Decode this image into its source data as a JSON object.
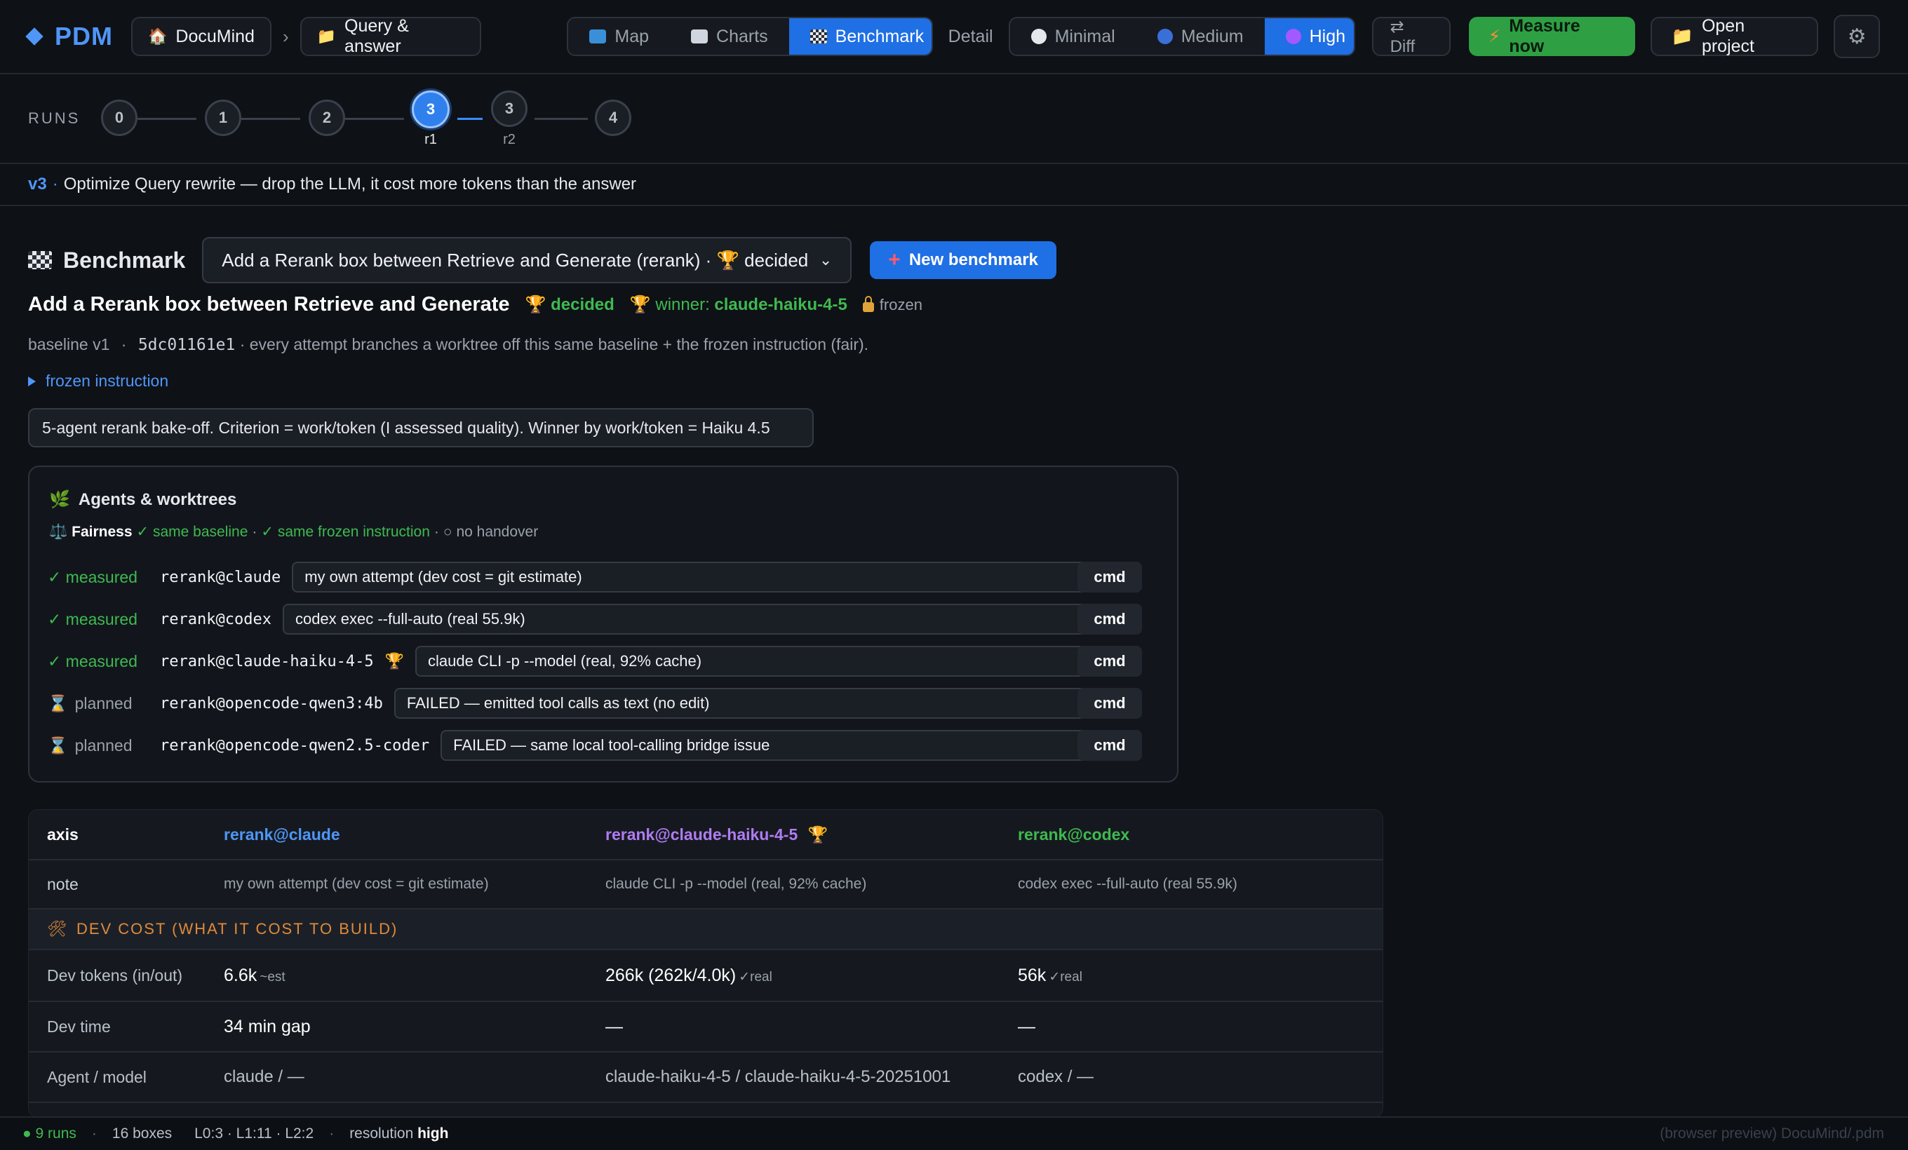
{
  "app": {
    "name": "PDM"
  },
  "breadcrumb": {
    "project": "DocuMind",
    "separator": "›",
    "section": "Query & answer"
  },
  "view_tabs": [
    {
      "label": "Map",
      "icon": "map-icon",
      "active": false
    },
    {
      "label": "Charts",
      "icon": "chart-icon",
      "active": false
    },
    {
      "label": "Benchmark",
      "icon": "checkered-flag-icon",
      "active": true
    }
  ],
  "detail": {
    "label": "Detail",
    "options": [
      {
        "label": "Minimal",
        "color": "#e6e8ec",
        "active": false
      },
      {
        "label": "Medium",
        "color": "#3b6fd8",
        "active": false
      },
      {
        "label": "High",
        "color": "#a259ff",
        "active": true
      }
    ]
  },
  "actions": {
    "diff": "⇄ Diff",
    "measure": "Measure now",
    "open": "Open project"
  },
  "runs": {
    "label": "RUNS",
    "nodes": [
      {
        "label": "0",
        "sub": "",
        "active": false
      },
      {
        "label": "1",
        "sub": "",
        "active": false
      },
      {
        "label": "2",
        "sub": "",
        "active": false
      },
      {
        "label": "3",
        "sub": "r1",
        "active": true
      },
      {
        "label": "3",
        "sub": "r2",
        "active": false
      },
      {
        "label": "4",
        "sub": "",
        "active": false
      }
    ]
  },
  "version_strip": {
    "tag": "v3",
    "sep": "·",
    "text": "Optimize Query rewrite — drop the LLM, it cost more tokens than the answer"
  },
  "benchmark": {
    "title": "Benchmark",
    "select_value": "Add a Rerank box between Retrieve and Generate (rerank) · 🏆 decided",
    "new_button": "New benchmark",
    "name": "Add a Rerank box between Retrieve and Generate",
    "decided": "🏆 decided",
    "winner_prefix": "🏆 winner:",
    "winner": "claude-haiku-4-5",
    "frozen": "frozen",
    "baseline_label": "baseline v1",
    "baseline_dot": "·",
    "baseline_hash": "5dc01161e1",
    "baseline_text": "· every attempt branches a worktree off this same baseline + the frozen instruction (fair).",
    "frozen_toggle": "frozen instruction",
    "instruction": "5-agent rerank bake-off. Criterion = work/token (I assessed quality). Winner by work/token = Haiku 4.5"
  },
  "agents": {
    "title": "Agents & worktrees",
    "fairness_label": "Fairness",
    "fairness_ok1": "✓ same baseline",
    "fairness_ok2": "✓ same frozen instruction",
    "fairness_handover": "○ no handover",
    "dot": "·",
    "rows": [
      {
        "status": "✓ measured",
        "kind": "measured",
        "name": "rerank@claude",
        "winner": false,
        "note": "my own attempt (dev cost = git estimate)",
        "cmd": "cmd"
      },
      {
        "status": "✓ measured",
        "kind": "measured",
        "name": "rerank@codex",
        "winner": false,
        "note": "codex exec --full-auto (real 55.9k)",
        "cmd": "cmd"
      },
      {
        "status": "✓ measured",
        "kind": "measured",
        "name": "rerank@claude-haiku-4-5",
        "winner": true,
        "note": "claude CLI -p --model (real, 92% cache)",
        "cmd": "cmd"
      },
      {
        "status": "planned",
        "kind": "planned",
        "name": "rerank@opencode-qwen3:4b",
        "winner": false,
        "note": "FAILED — emitted tool calls as text (no edit)",
        "cmd": "cmd"
      },
      {
        "status": "planned",
        "kind": "planned",
        "name": "rerank@opencode-qwen2.5-coder",
        "winner": false,
        "note": "FAILED — same local tool-calling bridge issue",
        "cmd": "cmd"
      }
    ]
  },
  "table": {
    "headers": {
      "axis": "axis",
      "a": "rerank@claude",
      "b": "rerank@claude-haiku-4-5",
      "b_trophy": "🏆",
      "c": "rerank@codex"
    },
    "note": {
      "label": "note",
      "a": "my own attempt (dev cost = git estimate)",
      "b": "claude CLI -p --model (real, 92% cache)",
      "c": "codex exec --full-auto (real 55.9k)"
    },
    "section": "DEV COST (WHAT IT COST TO BUILD)",
    "rows": [
      {
        "label": "Dev tokens (in/out)",
        "a": "6.6k",
        "a_tag": "~est",
        "b": "266k (262k/4.0k)",
        "b_tag": "✓real",
        "c": "56k",
        "c_tag": "✓real"
      },
      {
        "label": "Dev time",
        "a": "34 min gap",
        "a_tag": "",
        "b": "—",
        "b_tag": "",
        "c": "—",
        "c_tag": ""
      },
      {
        "label": "Agent / model",
        "a": "claude / —",
        "a_tag": "",
        "b": "claude-haiku-4-5 / claude-haiku-4-5-20251001",
        "b_tag": "",
        "c": "codex / —",
        "c_tag": ""
      }
    ]
  },
  "footer": {
    "runs": "● 9 runs",
    "boxes": "16 boxes",
    "levels": "L0:3 · L1:11 · L2:2",
    "resolution_label": "resolution",
    "resolution_value": "high",
    "preview": "(browser preview) DocuMind/.pdm",
    "sep": "·"
  }
}
